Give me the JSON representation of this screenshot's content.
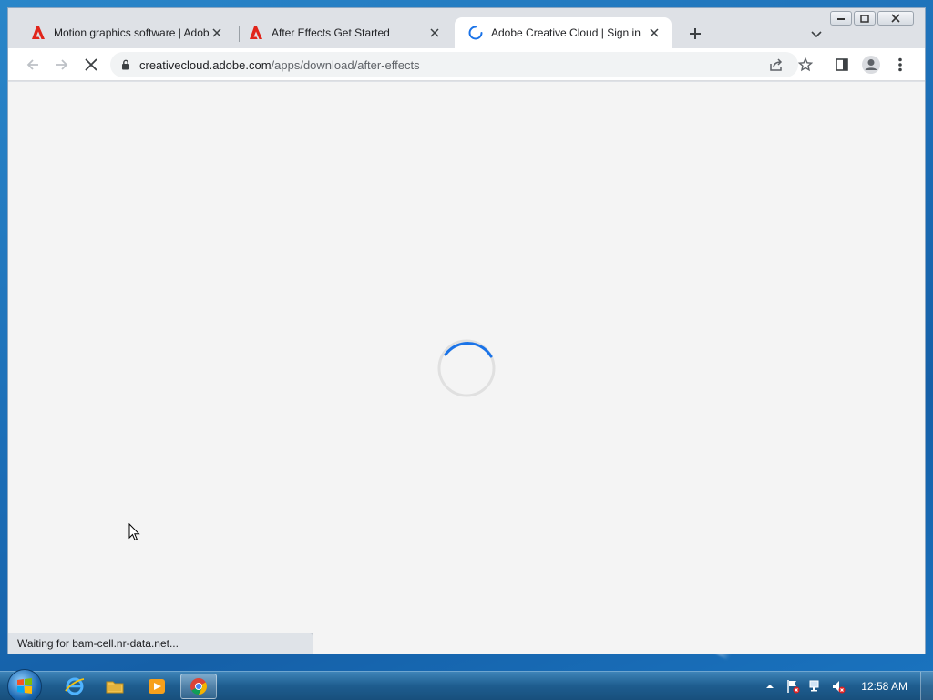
{
  "browser": {
    "tabs": [
      {
        "title": "Motion graphics software | Adobe",
        "favicon": "adobe-icon",
        "active": false
      },
      {
        "title": "After Effects Get Started",
        "favicon": "adobe-icon",
        "active": false
      },
      {
        "title": "Adobe Creative Cloud | Sign in",
        "favicon": "loading-spinner-icon",
        "active": true
      }
    ],
    "address": {
      "host": "creativecloud.adobe.com",
      "path": "/apps/download/after-effects"
    },
    "status_text": "Waiting for bam-cell.nr-data.net...",
    "accent_color": "#1a73e8",
    "adobe_red": "#e1251b"
  },
  "taskbar": {
    "pinned": [
      "internet-explorer-icon",
      "file-explorer-icon",
      "media-player-icon",
      "chrome-icon"
    ],
    "clock": "12:58 AM"
  }
}
